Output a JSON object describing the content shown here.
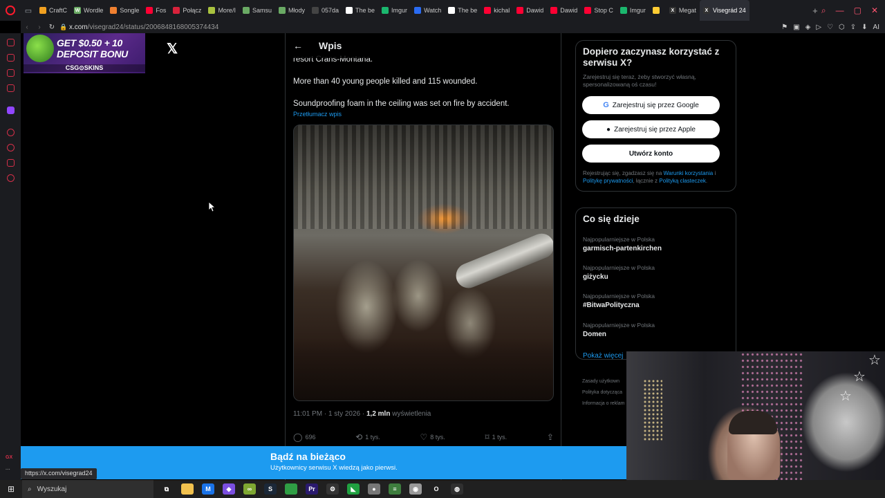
{
  "browser": {
    "tabs": [
      {
        "label": "CraftC",
        "color": "#f0a020",
        "glyph": ""
      },
      {
        "label": "Wordle",
        "color": "#6aaa64",
        "glyph": "W"
      },
      {
        "label": "Songle",
        "color": "#f08030",
        "glyph": ""
      },
      {
        "label": "Fos",
        "color": "#ff0033",
        "glyph": ""
      },
      {
        "label": "Połącz",
        "color": "#d8223b",
        "glyph": ""
      },
      {
        "label": "More/I",
        "color": "#a9c23f",
        "glyph": ""
      },
      {
        "label": "Samsu",
        "color": "#6aaa64",
        "glyph": ""
      },
      {
        "label": "Młody",
        "color": "#6aaa64",
        "glyph": ""
      },
      {
        "label": "057da",
        "color": "#444444",
        "glyph": ""
      },
      {
        "label": "The be",
        "color": "#ffffff",
        "glyph": ""
      },
      {
        "label": "Imgur",
        "color": "#1bb76e",
        "glyph": ""
      },
      {
        "label": "Watch",
        "color": "#2a6bf2",
        "glyph": ""
      },
      {
        "label": "The be",
        "color": "#ffffff",
        "glyph": ""
      },
      {
        "label": "kichal",
        "color": "#ff0033",
        "glyph": ""
      },
      {
        "label": "Dawid",
        "color": "#ff0033",
        "glyph": ""
      },
      {
        "label": "Dawid",
        "color": "#ff0033",
        "glyph": ""
      },
      {
        "label": "Stop C",
        "color": "#ff0033",
        "glyph": ""
      },
      {
        "label": "Imgur",
        "color": "#1bb76e",
        "glyph": ""
      },
      {
        "label": "",
        "color": "#ffcc33",
        "glyph": ""
      },
      {
        "label": "Megat",
        "color": "#333333",
        "glyph": "X"
      },
      {
        "label": "Visegrád 24",
        "color": "#333333",
        "glyph": "X",
        "active": true
      }
    ],
    "url_domain": "x.com",
    "url_path": "/visegrad24/status/2006848168005374434",
    "address_icons": [
      "⚑",
      "▣",
      "◈",
      "▷",
      "♡",
      "⬡",
      "⇪",
      "⬇",
      "AI"
    ]
  },
  "ad": {
    "line1": "GET $0.50 + 10",
    "line2": "DEPOSIT BONU",
    "brand": "CSG⊙SKINS"
  },
  "post": {
    "header_title": "Wpis",
    "text_top": "resort Crans-Montana.",
    "text_1": "More than 40 young people killed and 115 wounded.",
    "text_2": "Soundproofing foam in the ceiling was set on fire by accident.",
    "translate": "Przetłumacz wpis",
    "meta_time": "11:01 PM · 1 sty 2026 · ",
    "meta_views_count": "1,2 mln",
    "meta_views_label": " wyświetlenia",
    "replies": "696",
    "reposts": "1 tys.",
    "likes": "8 tys.",
    "bookmarks": "1 tys."
  },
  "signup": {
    "title": "Dopiero zaczynasz korzystać z serwisu X?",
    "subtitle": "Zarejestruj się teraz, żeby stworzyć własną, spersonalizowaną oś czasu!",
    "google_btn": "Zarejestruj się przez Google",
    "apple_btn": "Zarejestruj się przez Apple",
    "create_btn": "Utwórz konto",
    "legal_1": "Rejestrując się, zgadzasz się na ",
    "legal_terms": "Warunki korzystania",
    "legal_2": " i ",
    "legal_privacy": "Politykę prywatności",
    "legal_3": ", łącznie z ",
    "legal_cookies": "Polityką clasteczek",
    "legal_4": "."
  },
  "trends": {
    "title": "Co się dzieje",
    "items": [
      {
        "context": "Najpopularniejsze w Polska",
        "name": "garmisch-partenkirchen"
      },
      {
        "context": "Najpopularniejsze w Polska",
        "name": "giżycku"
      },
      {
        "context": "Najpopularniejsze w Polska",
        "name": "#BitwaPolityczna"
      },
      {
        "context": "Najpopularniejsze w Polska",
        "name": "Domen"
      }
    ],
    "more": "Pokaż więcej"
  },
  "footer": {
    "line1": "Zasady użytkown",
    "line2": "Polityka dotycząca",
    "line3": "Informacja o reklam"
  },
  "banner": {
    "title": "Bądź na bieżąco",
    "subtitle": "Użytkownicy serwisu X wiedzą jako pierwsi."
  },
  "status_url": "https://x.com/visegrad24",
  "taskbar": {
    "search_placeholder": "Wyszukaj",
    "apps": [
      {
        "name": "task-view",
        "color": "#202020",
        "glyph": "⧉"
      },
      {
        "name": "file-explorer",
        "color": "#f2c14e",
        "glyph": ""
      },
      {
        "name": "app-m",
        "color": "#1a73e8",
        "glyph": "M"
      },
      {
        "name": "app-gem",
        "color": "#7b4fe0",
        "glyph": "◆"
      },
      {
        "name": "app-green",
        "color": "#7fa832",
        "glyph": "∞"
      },
      {
        "name": "steam",
        "color": "#1b2838",
        "glyph": "S"
      },
      {
        "name": "app-sheet",
        "color": "#2f9e44",
        "glyph": ""
      },
      {
        "name": "premiere",
        "color": "#2a1a6e",
        "glyph": "Pr"
      },
      {
        "name": "app-gear",
        "color": "#333333",
        "glyph": "⚙"
      },
      {
        "name": "app-leaf",
        "color": "#20a040",
        "glyph": "◣"
      },
      {
        "name": "app-ball",
        "color": "#777777",
        "glyph": "●"
      },
      {
        "name": "app-stack",
        "color": "#3e7d3e",
        "glyph": "≡"
      },
      {
        "name": "app-disc",
        "color": "#999999",
        "glyph": "◉"
      },
      {
        "name": "opera",
        "color": "#202020",
        "glyph": "O"
      },
      {
        "name": "obs",
        "color": "#303030",
        "glyph": "◍"
      }
    ]
  }
}
